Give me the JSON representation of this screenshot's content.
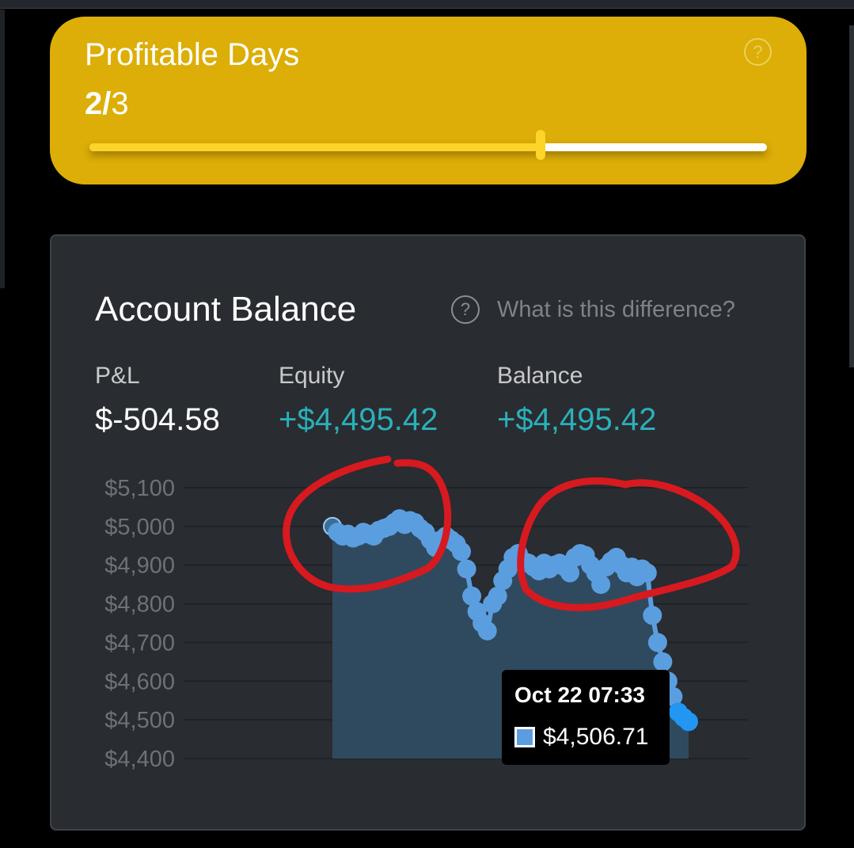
{
  "profitable_days": {
    "title": "Profitable Days",
    "achieved": "2",
    "separator": "/",
    "target": "3",
    "progress_fraction": 0.666,
    "help_icon": "question-circle-icon",
    "colors": {
      "card": "#dcae07",
      "fill": "#fcd42a",
      "track": "#ffffff"
    }
  },
  "account_balance": {
    "title": "Account Balance",
    "help_icon": "question-circle-icon",
    "help_text": "What is this difference?",
    "metrics": [
      {
        "label": "P&L",
        "value": "$-504.58"
      },
      {
        "label": "Equity",
        "value": "+$4,495.42"
      },
      {
        "label": "Balance",
        "value": "+$4,495.42"
      }
    ],
    "colors": {
      "positive": "#2bb0b9",
      "line": "#5b9ee0",
      "area": "#2f4a5e"
    }
  },
  "chart_data": {
    "type": "area",
    "y_ticks": [
      "$5,100",
      "$5,000",
      "$4,900",
      "$4,800",
      "$4,700",
      "$4,600",
      "$4,500",
      "$4,400"
    ],
    "ylim": [
      4400,
      5100
    ],
    "grid": true,
    "series": [
      {
        "values": [
          5000,
          4985,
          4975,
          4980,
          4970,
          4975,
          4985,
          4980,
          4975,
          4990,
          4995,
          5000,
          5010,
          5020,
          5005,
          5015,
          5010,
          4995,
          4985,
          4965,
          4945,
          4965,
          4975,
          4965,
          4955,
          4935,
          4890,
          4820,
          4780,
          4750,
          4730,
          4800,
          4820,
          4860,
          4890,
          4920,
          4930,
          4910,
          4905,
          4895,
          4885,
          4905,
          4890,
          4900,
          4905,
          4895,
          4880,
          4920,
          4930,
          4925,
          4900,
          4880,
          4850,
          4895,
          4910,
          4920,
          4900,
          4880,
          4895,
          4870,
          4890,
          4880,
          4770,
          4700,
          4650,
          4600,
          4560,
          4520,
          4506.71,
          4495.42
        ]
      }
    ],
    "tooltip": {
      "date": "Oct 22 07:33",
      "value": "$4,506.71"
    }
  },
  "annotations": {
    "circle_color": "#d71920"
  }
}
